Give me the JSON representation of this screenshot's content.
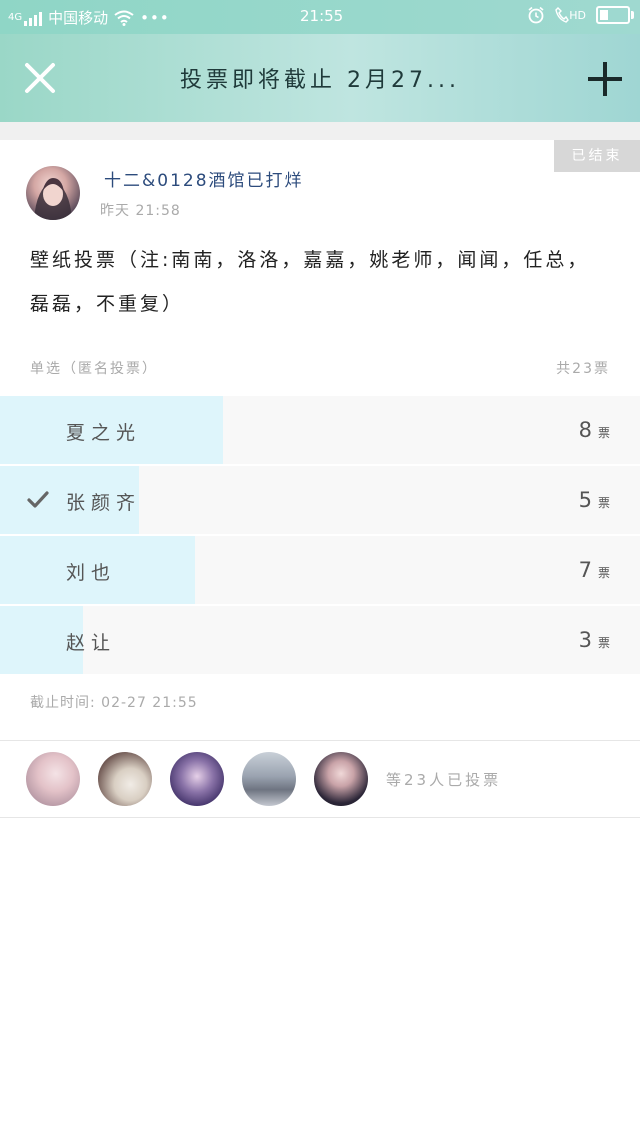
{
  "status_bar": {
    "network": "4G",
    "carrier": "中国移动",
    "more": "•••",
    "time": "21:55",
    "hd": "HD"
  },
  "header": {
    "title": "投票即将截止 2月27..."
  },
  "post": {
    "status_badge": "已结束",
    "author": "十二&0128酒馆已打烊",
    "time": "昨天 21:58",
    "content": "壁纸投票（注:南南，洛洛，嘉嘉，姚老师，闻闻，任总，磊磊，不重复）",
    "vote_type": "单选（匿名投票）",
    "total": "共23票"
  },
  "options": [
    {
      "label": "夏之光",
      "count": 8,
      "unit": "票",
      "fraction": 0.348,
      "selected": false
    },
    {
      "label": "张颜齐",
      "count": 5,
      "unit": "票",
      "fraction": 0.217,
      "selected": true
    },
    {
      "label": "刘也",
      "count": 7,
      "unit": "票",
      "fraction": 0.304,
      "selected": false
    },
    {
      "label": "赵让",
      "count": 3,
      "unit": "票",
      "fraction": 0.13,
      "selected": false
    }
  ],
  "deadline": "截止时间: 02-27 21:55",
  "voters": {
    "summary": "等23人已投票",
    "avatars": [
      "avatar-1",
      "avatar-2",
      "avatar-3",
      "avatar-4",
      "avatar-5"
    ]
  },
  "colors": {
    "header_start": "#9ad7c7",
    "header_end": "#9fd6d3",
    "option_fill": "#def5fb",
    "author_name": "#2c4b7c"
  }
}
